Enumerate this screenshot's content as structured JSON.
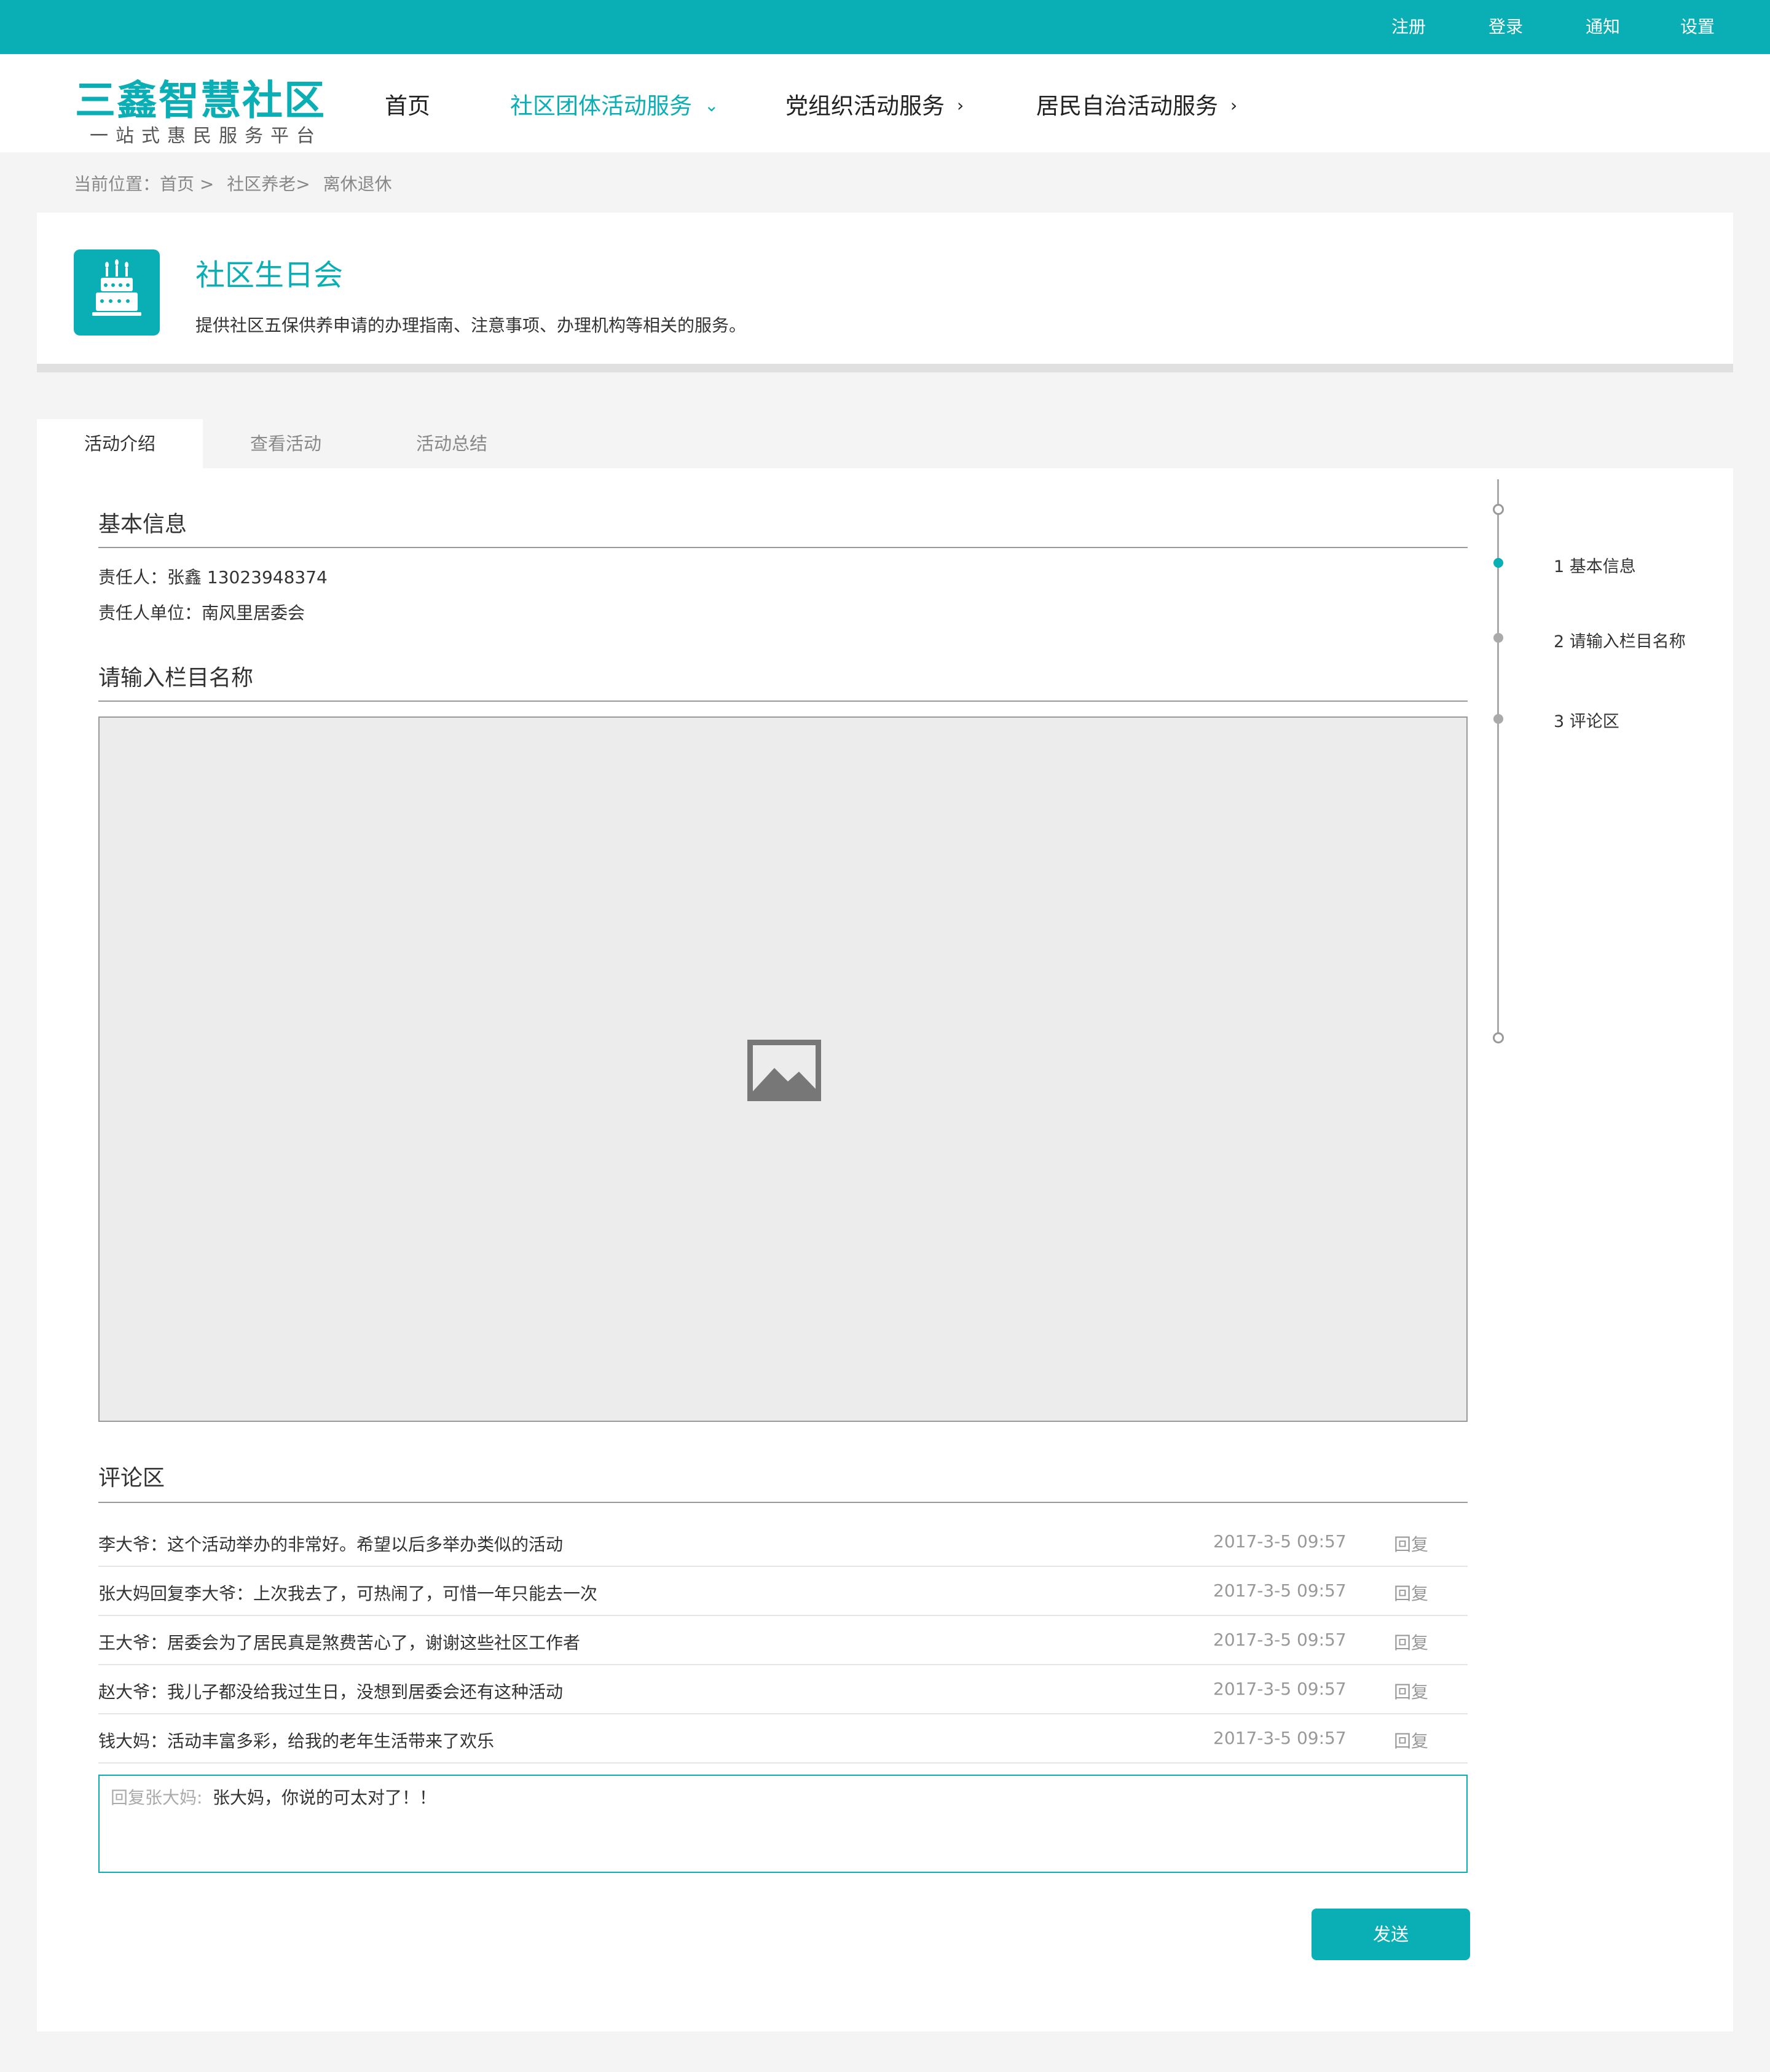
{
  "topbar": {
    "links": [
      "注册",
      "登录",
      "通知",
      "设置"
    ]
  },
  "brand": {
    "name": "三鑫智慧社区",
    "tagline": "一站式惠民服务平台"
  },
  "nav": {
    "items": [
      {
        "label": "首页"
      },
      {
        "label": "社区团体活动服务",
        "chevron": "⌄"
      },
      {
        "label": "党组织活动服务",
        "chevron": "›"
      },
      {
        "label": "居民自治活动服务",
        "chevron": "›"
      }
    ]
  },
  "breadcrumb": [
    "当前位置：首页 >",
    "社区养老>",
    "离休退休"
  ],
  "service": {
    "icon": "birthday-cake-icon",
    "title": "社区生日会",
    "description": "提供社区五保供养申请的办理指南、注意事项、办理机构等相关的服务。"
  },
  "tabs": [
    "活动介绍",
    "查看活动",
    "活动总结"
  ],
  "basic_info": {
    "heading": "基本信息",
    "person": "责任人：张鑫  13023948374",
    "unit": "责任人单位：南风里居委会"
  },
  "column": {
    "heading": "请输入栏目名称",
    "image_icon": "image-placeholder-icon"
  },
  "comments": {
    "heading": "评论区",
    "reply_label": "回复",
    "items": [
      {
        "text": "李大爷：这个活动举办的非常好。希望以后多举办类似的活动",
        "time": "2017-3-5 09:57"
      },
      {
        "text": "张大妈回复李大爷：上次我去了，可热闹了，可惜一年只能去一次",
        "time": "2017-3-5 09:57"
      },
      {
        "text": "王大爷：居委会为了居民真是煞费苦心了，谢谢这些社区工作者",
        "time": "2017-3-5 09:57"
      },
      {
        "text": "赵大爷：我儿子都没给我过生日，没想到居委会还有这种活动",
        "time": "2017-3-5 09:57"
      },
      {
        "text": "钱大妈：活动丰富多彩，给我的老年生活带来了欢乐",
        "time": "2017-3-5 09:57"
      }
    ]
  },
  "reply_input": {
    "label": "回复张大妈:",
    "value": "张大妈，你说的可太对了！！"
  },
  "send_button": "发送",
  "timeline": {
    "items": [
      "1  基本信息",
      "2  请输入栏目名称",
      "3  评论区"
    ],
    "active_index": 0
  },
  "colors": {
    "accent": "#0aafb6",
    "page_bg": "#f4f4f4"
  }
}
